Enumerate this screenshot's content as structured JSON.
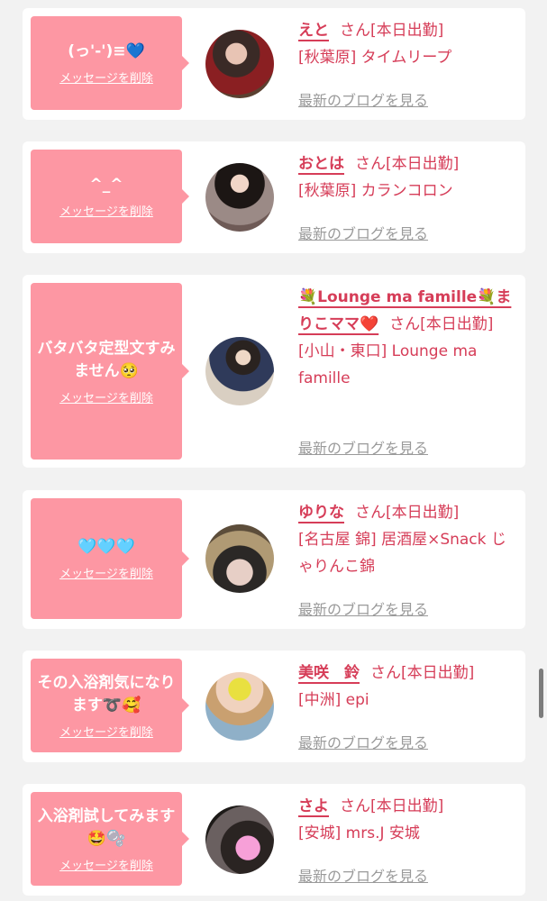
{
  "delete_label": "メッセージを削除",
  "blog_label": "最新のブログを見る",
  "colors": {
    "bubble": "#fd97a3",
    "accent": "#d63d58",
    "link_gray": "#9a9a9a",
    "card": "#ffffff",
    "background": "#f2f2f2"
  },
  "items": [
    {
      "message": "(っ'-')≡💙",
      "name": "えと",
      "honorific": "さん",
      "status": "[本日出勤]",
      "shop": "[秋葉原] タイムリープ"
    },
    {
      "message": "^_^",
      "name": "おとは",
      "honorific": "さん",
      "status": "[本日出勤]",
      "shop": "[秋葉原] カランコロン"
    },
    {
      "message": "バタバタ定型文すみません🥺",
      "name": "💐Lounge ma famille💐まりこママ❤️",
      "honorific": "さん",
      "status": "[本日出勤]",
      "shop": "[小山・東口] Lounge ma famille"
    },
    {
      "message": "🩵🩵🩵",
      "name": "ゆりな",
      "honorific": "さん",
      "status": "[本日出勤]",
      "shop": "[名古屋 錦] 居酒屋×Snack じゃりんこ錦"
    },
    {
      "message": "その入浴剤気になります➰🥰",
      "name": "美咲　鈴",
      "honorific": "さん",
      "status": "[本日出勤]",
      "shop": "[中洲] epi"
    },
    {
      "message": "入浴剤試してみます🤩🫧",
      "name": "さよ",
      "honorific": "さん",
      "status": "[本日出勤]",
      "shop": "[安城] mrs.J 安城"
    }
  ]
}
